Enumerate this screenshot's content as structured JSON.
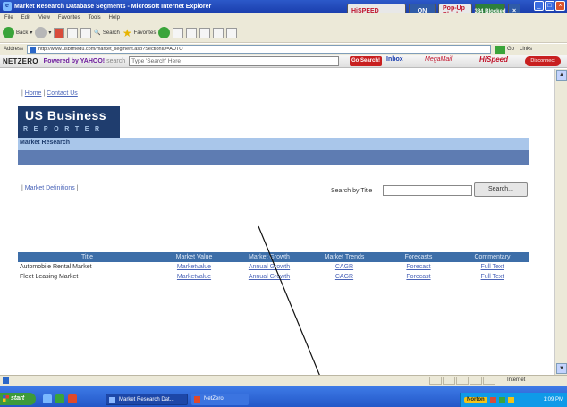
{
  "window": {
    "title": "Market Research Database Segments - Microsoft Internet Explorer",
    "badges": {
      "hispeed": "HiSPEED",
      "on": "ON",
      "popup": "Pop-Up Blocker",
      "blocked_count": "384",
      "blocked_label": "Blocked"
    }
  },
  "menu": {
    "items": [
      "File",
      "Edit",
      "View",
      "Favorites",
      "Tools",
      "Help"
    ]
  },
  "toolbar": {
    "back": "Back",
    "search": "Search",
    "favorites": "Favorites"
  },
  "address": {
    "label": "Address",
    "url": "http://www.usbrmedu.com/market_segment.asp?SectionID=AUTO",
    "go": "Go",
    "links": "Links"
  },
  "netzero": {
    "logo": "NETZERO",
    "powered_by": "Powered by YAHOO!",
    "search_label": "search",
    "search_placeholder": "Type 'Search' Here",
    "go_search": "Go Search!",
    "inbox": "Inbox",
    "megamail": "MegaMail",
    "hispeed": "HiSpeed",
    "disconnect": "Disconnect"
  },
  "page": {
    "home_link": "Home",
    "contact_link": "Contact Us",
    "brand_top": "US Business",
    "brand_bottom": "REPORTER",
    "section_title": "Market Research",
    "definitions_link": "Market Definitions",
    "search_by_title_label": "Search by Title",
    "search_button": "Search...",
    "table": {
      "headers": [
        "Title",
        "Market Value",
        "Market Growth",
        "Market Trends",
        "Forecasts",
        "Commentary"
      ],
      "rows": [
        [
          "Automobile Rental Market",
          "Marketvalue",
          "Annual Growth",
          "CAGR",
          "Forecast",
          "Full Text"
        ],
        [
          "Fleet Leasing Market",
          "Marketvalue",
          "Annual Growth",
          "CAGR",
          "Forecast",
          "Full Text"
        ]
      ]
    }
  },
  "statusbar": {
    "zone": "Internet"
  },
  "taskbar": {
    "start": "start",
    "task1": "Market Research Dat...",
    "task2": "NetZero",
    "norton": "Norton",
    "clock": "1:09 PM"
  },
  "colors": {
    "brand_dark": "#1f3d6e",
    "brand_light": "#a9c6ea",
    "table_header": "#3d6ea8",
    "link": "#4a64b8"
  }
}
